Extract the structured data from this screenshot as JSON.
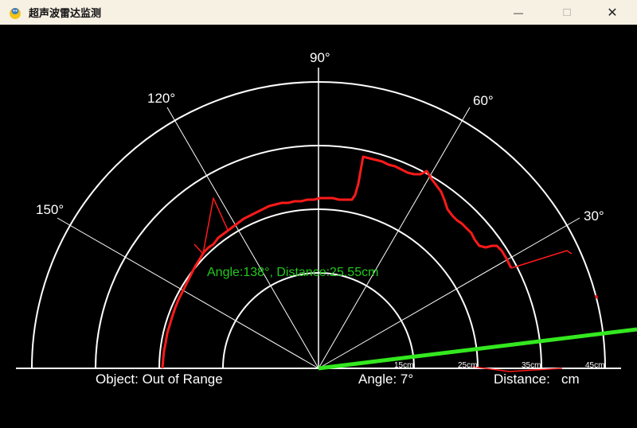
{
  "window": {
    "title": "超声波雷达监测",
    "buttons": {
      "minimize": "—",
      "maximize": "□",
      "close": "✕"
    }
  },
  "radar": {
    "angle_labels": [
      "30°",
      "60°",
      "90°",
      "120°",
      "150°"
    ],
    "ring_labels": [
      "15cm",
      "25cm",
      "35cm",
      "45cm"
    ],
    "hover_text": "Angle:138°, Distance:25.55cm",
    "status": {
      "object": "Object: Out of Range",
      "angle": "Angle: 7°",
      "distance": "Distance:   cm"
    },
    "sweep_angle_deg": 7,
    "colors": {
      "sweep": "#33e81f",
      "trace": "#ff1a1a",
      "grid": "#ffffff",
      "hover_text": "#23c81d"
    }
  }
}
